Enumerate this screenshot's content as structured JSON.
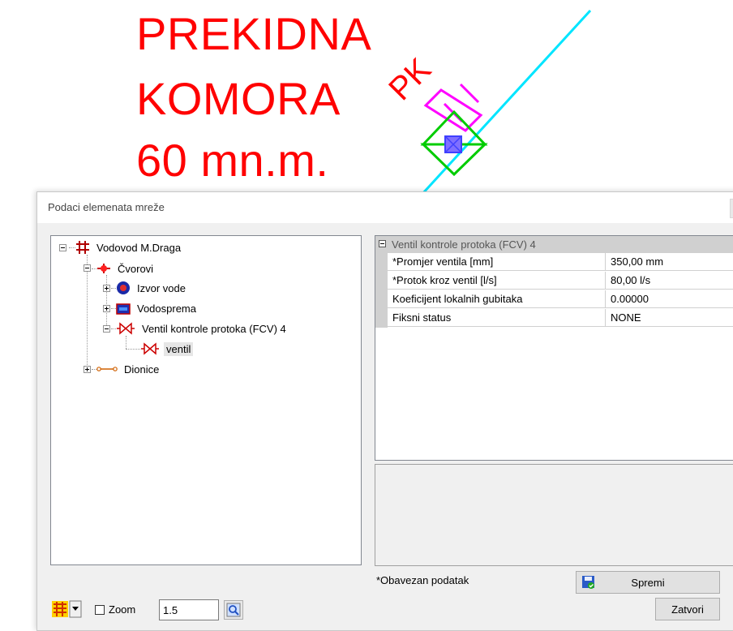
{
  "drawing": {
    "label_lines": [
      "PREKIDNA",
      "KOMORA",
      "60 mn.m."
    ],
    "symbol_label": "PK"
  },
  "dialog": {
    "title": "Podaci elemenata mreže"
  },
  "tree": {
    "root": "Vodovod M.Draga",
    "nodes": "Čvorovi",
    "source": "Izvor vode",
    "reservoir": "Vodosprema",
    "valve_group": "Ventil kontrole protoka (FCV) 4",
    "valve_item": "ventil",
    "sections": "Dionice"
  },
  "properties": {
    "header": "Ventil kontrole protoka (FCV) 4",
    "rows": [
      {
        "name": "*Promjer ventila [mm]",
        "value": "350,00 mm"
      },
      {
        "name": "*Protok kroz ventil [l/s]",
        "value": "80,00 l/s"
      },
      {
        "name": "Koeficijent lokalnih gubitaka",
        "value": "0.00000"
      },
      {
        "name": "Fiksni status",
        "value": "NONE"
      }
    ]
  },
  "footer": {
    "required_note": "*Obavezan podatak",
    "save_label": "Spremi",
    "close_label": "Zatvori",
    "zoom_label": "Zoom",
    "zoom_value": "1.5"
  }
}
